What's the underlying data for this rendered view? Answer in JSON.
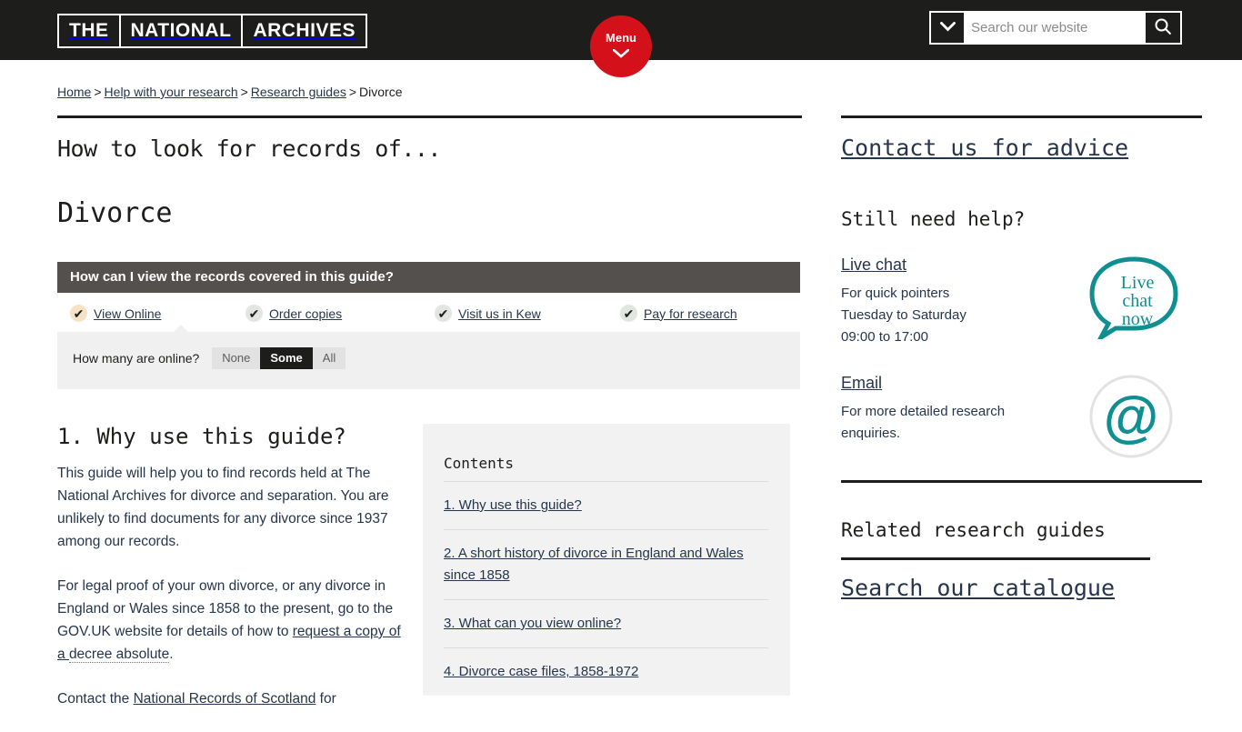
{
  "header": {
    "logo": [
      "THE",
      "NATIONAL",
      "ARCHIVES"
    ],
    "menu_label": "Menu",
    "menu_icon": "chevron-down-icon",
    "search_placeholder": "Search our website",
    "search_value": "",
    "search_toggle_icon": "chevron-down-icon",
    "search_submit_icon": "search-icon"
  },
  "breadcrumb": {
    "items": [
      {
        "label": "Home",
        "link": true
      },
      {
        "label": "Help with your research",
        "link": true
      },
      {
        "label": "Research guides",
        "link": true
      },
      {
        "label": "Divorce",
        "link": false
      }
    ],
    "separator": ">"
  },
  "article": {
    "kicker": "How to look for records of...",
    "title": "Divorce"
  },
  "view_panel": {
    "heading": "How can I view the records covered in this guide?",
    "tabs": [
      {
        "label": "View Online",
        "icon": "check-icon",
        "active": true
      },
      {
        "label": "Order copies",
        "icon": "check-icon",
        "active": false
      },
      {
        "label": "Visit us in Kew",
        "icon": "check-icon",
        "active": false
      },
      {
        "label": "Pay for research",
        "icon": "check-icon",
        "active": false
      }
    ],
    "question": "How many are online?",
    "options": [
      {
        "label": "None",
        "selected": false
      },
      {
        "label": "Some",
        "selected": true
      },
      {
        "label": "All",
        "selected": false
      }
    ]
  },
  "section": {
    "heading": "1. Why use this guide?",
    "paragraph_1": "This guide will help you to find records held at The National Archives for divorce and separation. You are unlikely to find documents for any divorce since 1937 among our records.",
    "paragraph_2_pre": "For legal proof of your own divorce, or any divorce in England or Wales since 1858 to the present, go to the GOV.UK website for details of how to ",
    "paragraph_2_link": "request a copy of a ",
    "paragraph_2_glossary": "decree absolute",
    "paragraph_2_post": ".",
    "paragraph_3_pre": "Contact the ",
    "paragraph_3_link": "National Records of Scotland",
    "paragraph_3_post": " for"
  },
  "contents": {
    "title": "Contents",
    "items": [
      "1. Why use this guide?",
      "2. A short history of divorce in England and Wales since 1858",
      "3. What can you view online?",
      "4. Divorce case files, 1858-1972"
    ]
  },
  "sidebar": {
    "contact_heading": "Contact us for advice",
    "still_need_help": "Still need help?",
    "live_chat": {
      "link": "Live chat",
      "line_1": "For quick pointers",
      "line_2": "Tuesday to Saturday",
      "line_3": "09:00 to 17:00",
      "icon_name": "live-chat-bubble-icon",
      "icon_text": [
        "Live",
        "chat",
        "now"
      ]
    },
    "email": {
      "link": "Email",
      "line_1": "For more detailed research",
      "line_2": "enquiries.",
      "icon_name": "at-sign-icon",
      "icon_glyph": "@"
    },
    "related_heading": "Related research guides",
    "catalogue_heading": "Search our catalogue"
  },
  "colors": {
    "header_bg": "#1d1d1b",
    "accent_red": "#d4111a",
    "teal": "#0f8f92",
    "link": "#25354c",
    "panel_head": "#54504e",
    "panel_body": "#f0f0f0",
    "contents_bg": "#f2f2f2"
  }
}
